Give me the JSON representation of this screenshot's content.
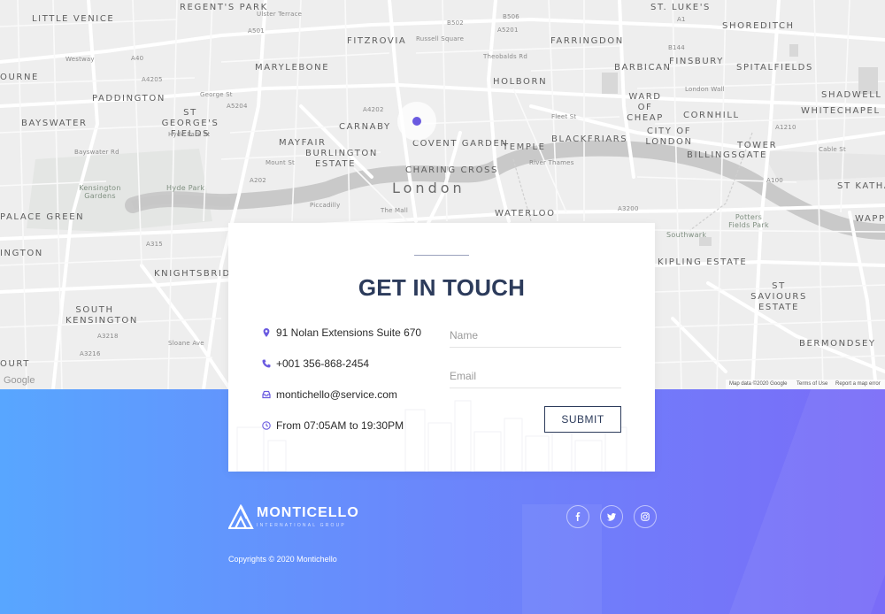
{
  "map": {
    "city_label": "London",
    "districts": [
      "Little Venice",
      "Regent's Park",
      "St. Luke's",
      "Fitzrovia",
      "Farringdon",
      "Shoreditch",
      "Marylebone",
      "Finsbury",
      "Spitalfields",
      "Barbican",
      "Paddington",
      "Holborn",
      "Ward of Cheap",
      "Shadwell",
      "Bayswater",
      "St George's Fields",
      "Carnaby",
      "Covent Garden",
      "City of London",
      "Cornhill",
      "Whitechapel",
      "Mayfair",
      "Burlington Estate",
      "Temple",
      "Blackfriars",
      "Tower",
      "Billingsgate",
      "Charing Cross",
      "Waterloo",
      "St Katha",
      "Palace Green",
      "Southwark",
      "Wappi",
      "Kipling Estate",
      "St Saviours Estate",
      "Knightsbridg",
      "South Kensington",
      "Bermondsey",
      "Ourne",
      "Ourt"
    ],
    "parks": [
      "Kensington Gardens",
      "Hyde Park",
      "Potters Fields Park"
    ],
    "roads": [
      "Ulster Terrace",
      "Russell Square",
      "A501",
      "A40",
      "A4205",
      "A5204",
      "B506",
      "B502",
      "A5201",
      "A1",
      "B144",
      "Westway",
      "George St",
      "Theobalds Rd",
      "Fleet St",
      "London Wall",
      "Mount St",
      "Bayswater Rd",
      "Hyde Park St",
      "Piccadilly",
      "The Mall",
      "River Thames",
      "A3200",
      "A3216",
      "A3218",
      "Sloane Ave",
      "A315",
      "A202",
      "A4202",
      "A100",
      "A1210",
      "Cable St"
    ],
    "footer_links": [
      "Map data ©2020 Google",
      "Terms of Use",
      "Report a map error"
    ],
    "logo": "Google"
  },
  "contact": {
    "title": "GET IN TOUCH",
    "address": "91 Nolan Extensions Suite 670",
    "phone": "+001 356-868-2454",
    "email": "montichello@service.com",
    "hours": "From 07:05AM to 19:30PM",
    "form": {
      "name_placeholder": "Name",
      "email_placeholder": "Email",
      "submit_label": "SUBMIT"
    }
  },
  "footer": {
    "brand_name": "MONTICELLO",
    "brand_tagline": "INTERNATIONAL GROUP",
    "copyright": "Copyrights © 2020 Montichello",
    "social": [
      {
        "name": "facebook",
        "icon": "facebook-icon"
      },
      {
        "name": "twitter",
        "icon": "twitter-icon"
      },
      {
        "name": "instagram",
        "icon": "instagram-icon"
      }
    ]
  },
  "colors": {
    "accent": "#6a5ae0",
    "heading": "#2c3b5b",
    "gradient_start": "#58a6ff",
    "gradient_end": "#7a6cf8",
    "map_bg": "#eeeeee"
  }
}
